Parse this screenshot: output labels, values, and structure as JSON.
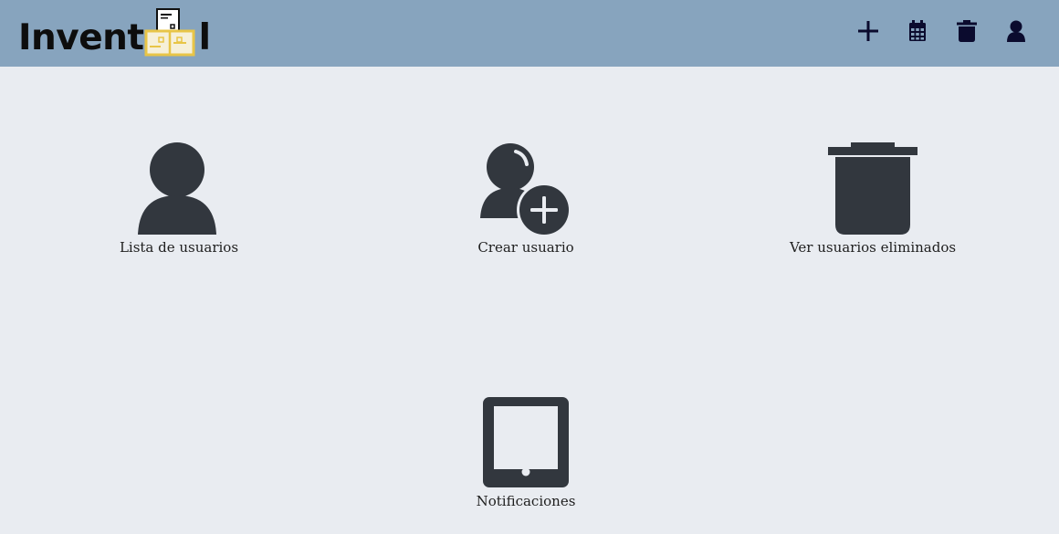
{
  "brand": {
    "text_before": "Invent",
    "text_after": "l"
  },
  "header": {
    "icons": [
      "add-icon",
      "calendar-icon",
      "trash-icon",
      "user-icon"
    ]
  },
  "tiles": [
    {
      "label": "Lista de usuarios",
      "icon": "user-icon"
    },
    {
      "label": "Crear usuario",
      "icon": "user-add-icon"
    },
    {
      "label": "Ver usuarios eliminados",
      "icon": "trash-icon"
    },
    {
      "label": "Notificaciones",
      "icon": "tablet-icon"
    }
  ],
  "colors": {
    "header_bg": "#87a4be",
    "page_bg": "#e9ecf1",
    "icon_dark": "#32373e",
    "nav_icon": "#0b0b2e",
    "logo_accent": "#e8c547"
  }
}
